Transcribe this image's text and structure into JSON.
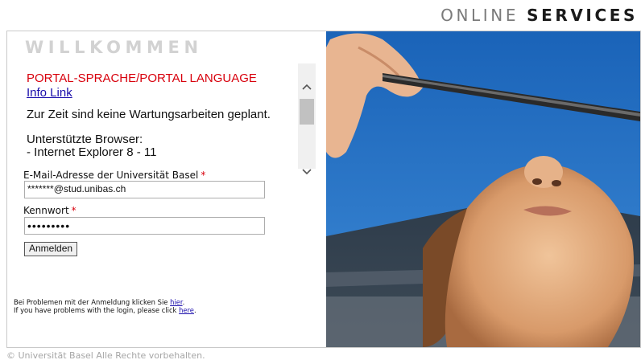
{
  "header": {
    "brand_light": "ONLINE",
    "brand_bold": "SERVICES"
  },
  "welcome": "WILLKOMMEN",
  "news": {
    "language_link": "PORTAL-SPRACHE/PORTAL LANGUAGE",
    "info_link": "Info Link",
    "maintenance": "Zur Zeit sind keine Wartungsarbeiten geplant.",
    "browsers_heading": "Unterstützte Browser:",
    "browsers_value": "- Internet Explorer 8 - 11"
  },
  "login": {
    "email_label": "E-Mail-Adresse der Universität Basel",
    "email_required": "*",
    "email_value": "*******@stud.unibas.ch",
    "password_label": "Kennwort",
    "password_required": "*",
    "password_value": "•••••••••",
    "submit": "Anmelden"
  },
  "help": {
    "de_text": "Bei Problemen mit der Anmeldung klicken Sie ",
    "de_link": "hier",
    "de_end": ".",
    "en_text": "If you have problems with the login, please click ",
    "en_link": "here",
    "en_end": "."
  },
  "footer": {
    "copyright": "© Universität Basel Alle Rechte vorbehalten."
  },
  "icons": {
    "scroll_up": "chevron-up-icon",
    "scroll_down": "chevron-down-icon"
  },
  "colors": {
    "required": "#d8000c",
    "link": "#1a0dab",
    "sky": "#1f74c8"
  }
}
